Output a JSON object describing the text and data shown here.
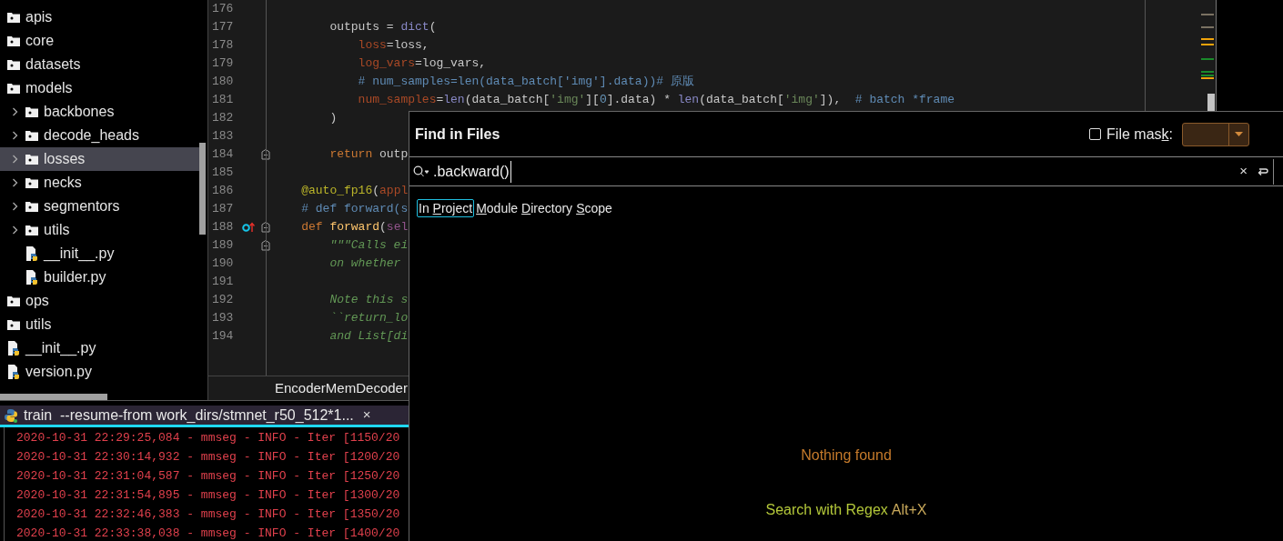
{
  "project_tree": [
    {
      "label": "apis",
      "kind": "folder",
      "selected": false
    },
    {
      "label": "core",
      "kind": "folder",
      "selected": false
    },
    {
      "label": "datasets",
      "kind": "folder",
      "selected": false
    },
    {
      "label": "models",
      "kind": "folder",
      "selected": false,
      "children": [
        {
          "label": "backbones",
          "kind": "folder",
          "selected": false,
          "expanded": false
        },
        {
          "label": "decode_heads",
          "kind": "folder",
          "selected": false,
          "expanded": false
        },
        {
          "label": "losses",
          "kind": "folder",
          "selected": true,
          "expanded": false
        },
        {
          "label": "necks",
          "kind": "folder",
          "selected": false,
          "expanded": false
        },
        {
          "label": "segmentors",
          "kind": "folder",
          "selected": false,
          "expanded": false
        },
        {
          "label": "utils",
          "kind": "folder",
          "selected": false,
          "expanded": false
        },
        {
          "label": "__init__.py",
          "kind": "python",
          "selected": false
        },
        {
          "label": "builder.py",
          "kind": "python",
          "selected": false
        }
      ]
    },
    {
      "label": "ops",
      "kind": "folder",
      "selected": false
    },
    {
      "label": "utils",
      "kind": "folder",
      "selected": false
    },
    {
      "label": "__init__.py",
      "kind": "python",
      "selected": false
    },
    {
      "label": "version.py",
      "kind": "python",
      "selected": false
    }
  ],
  "editor": {
    "lines": [
      {
        "number": "176",
        "fold": false,
        "override": false
      },
      {
        "number": "177",
        "fold": false,
        "override": false,
        "tokens": [
          {
            "text": "        outputs = ",
            "kind": "plain"
          },
          {
            "text": "dict",
            "kind": "builtin"
          },
          {
            "text": "(",
            "kind": "plain"
          }
        ]
      },
      {
        "number": "178",
        "fold": false,
        "override": false,
        "tokens": [
          {
            "text": "            loss",
            "kind": "param"
          },
          {
            "text": "=loss,",
            "kind": "plain"
          }
        ]
      },
      {
        "number": "179",
        "fold": false,
        "override": false,
        "tokens": [
          {
            "text": "            log_vars",
            "kind": "param"
          },
          {
            "text": "=log_vars,",
            "kind": "plain"
          }
        ]
      },
      {
        "number": "180",
        "fold": false,
        "override": false,
        "tokens": [
          {
            "text": "            # num_samples=len(data_batch['img'].data))# 原版",
            "kind": "comment"
          }
        ]
      },
      {
        "number": "181",
        "fold": false,
        "override": false,
        "tokens": [
          {
            "text": "            num_samples",
            "kind": "param"
          },
          {
            "text": "=",
            "kind": "plain"
          },
          {
            "text": "len",
            "kind": "builtin"
          },
          {
            "text": "(data_batch[",
            "kind": "plain"
          },
          {
            "text": "'img'",
            "kind": "string"
          },
          {
            "text": "][",
            "kind": "plain"
          },
          {
            "text": "0",
            "kind": "number"
          },
          {
            "text": "].data) * ",
            "kind": "plain"
          },
          {
            "text": "len",
            "kind": "builtin"
          },
          {
            "text": "(data_batch[",
            "kind": "plain"
          },
          {
            "text": "'img'",
            "kind": "string"
          },
          {
            "text": "]),  ",
            "kind": "plain"
          },
          {
            "text": "# batch *frame",
            "kind": "comment"
          }
        ]
      },
      {
        "number": "182",
        "fold": false,
        "override": false,
        "tokens": [
          {
            "text": "        )",
            "kind": "plain"
          }
        ]
      },
      {
        "number": "183",
        "fold": false,
        "override": false
      },
      {
        "number": "184",
        "fold": true,
        "override": false,
        "tokens": [
          {
            "text": "        return",
            "kind": "keyword"
          },
          {
            "text": " outp",
            "kind": "plain"
          }
        ]
      },
      {
        "number": "185",
        "fold": false,
        "override": false
      },
      {
        "number": "186",
        "fold": false,
        "override": false,
        "tokens": [
          {
            "text": "    @auto_fp16",
            "kind": "decorator"
          },
          {
            "text": "(",
            "kind": "plain"
          },
          {
            "text": "appl",
            "kind": "param"
          }
        ]
      },
      {
        "number": "187",
        "fold": false,
        "override": false,
        "tokens": [
          {
            "text": "    # def forward(s",
            "kind": "comment"
          }
        ]
      },
      {
        "number": "188",
        "fold": true,
        "override": true,
        "tokens": [
          {
            "text": "    def",
            "kind": "keyword"
          },
          {
            "text": " forward",
            "kind": "function"
          },
          {
            "text": "(",
            "kind": "plain"
          },
          {
            "text": "sel",
            "kind": "self"
          }
        ]
      },
      {
        "number": "189",
        "fold": true,
        "override": false,
        "tokens": [
          {
            "text": "        \"\"\"Calls ei",
            "kind": "docstring"
          }
        ]
      },
      {
        "number": "190",
        "fold": false,
        "override": false,
        "tokens": [
          {
            "text": "        on whether ",
            "kind": "docstring"
          }
        ]
      },
      {
        "number": "191",
        "fold": false,
        "override": false
      },
      {
        "number": "192",
        "fold": false,
        "override": false,
        "tokens": [
          {
            "text": "        Note this s",
            "kind": "docstring"
          }
        ]
      },
      {
        "number": "193",
        "fold": false,
        "override": false,
        "tokens": [
          {
            "text": "        ``return_lo",
            "kind": "docstring"
          }
        ]
      },
      {
        "number": "194",
        "fold": false,
        "override": false,
        "tokens": [
          {
            "text": "        and List[di",
            "kind": "docstring"
          }
        ]
      }
    ],
    "breadcrumb": "EncoderMemDecoder"
  },
  "run_panel": {
    "tab": {
      "label": "train  --resume-from work_dirs/stmnet_r50_512*1...",
      "close": "×",
      "selected": true
    },
    "log_lines": [
      "2020-10-31 22:29:25,084 - mmseg - INFO - Iter [1150/20",
      "2020-10-31 22:30:14,932 - mmseg - INFO - Iter [1200/20",
      "2020-10-31 22:31:04,587 - mmseg - INFO - Iter [1250/20",
      "2020-10-31 22:31:54,895 - mmseg - INFO - Iter [1300/20",
      "2020-10-31 22:32:46,383 - mmseg - INFO - Iter [1350/20",
      "2020-10-31 22:33:38,038 - mmseg - INFO - Iter [1400/20"
    ]
  },
  "find_dialog": {
    "title": "Find in Files",
    "file_mask": {
      "checked": false,
      "label": {
        "before": "File mas",
        "key": "k",
        "after": ":"
      }
    },
    "search": {
      "value": ".backward()",
      "clear": "×"
    },
    "scopes": [
      {
        "before": "In ",
        "key": "P",
        "after": "roject",
        "selected": true
      },
      {
        "key": "M",
        "after": "odule",
        "selected": false
      },
      {
        "key": "D",
        "after": "irectory",
        "selected": false
      },
      {
        "key": "S",
        "after": "cope",
        "selected": false
      }
    ],
    "empty_message": "Nothing found",
    "regex_link": "Search with Regex",
    "regex_shortcut": "Alt+X"
  }
}
